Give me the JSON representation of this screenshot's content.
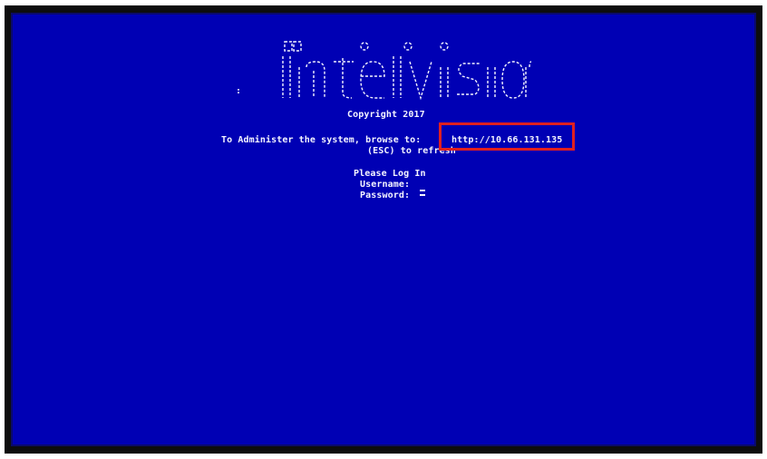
{
  "console": {
    "logo_text": "intelvision",
    "copyright": "Copyright 2017",
    "admin_prompt": "To Administer the system, browse to:",
    "admin_url": "http://10.66.131.135",
    "refresh_hint": "(ESC) to refresh",
    "login_prompt": "Please Log In",
    "username_label": "Username:",
    "password_label": "Password:"
  },
  "colors": {
    "screen_background": "#0000b4",
    "frame": "#0d0d0d",
    "text": "#f4f4ff",
    "highlight_box": "#e02020"
  }
}
